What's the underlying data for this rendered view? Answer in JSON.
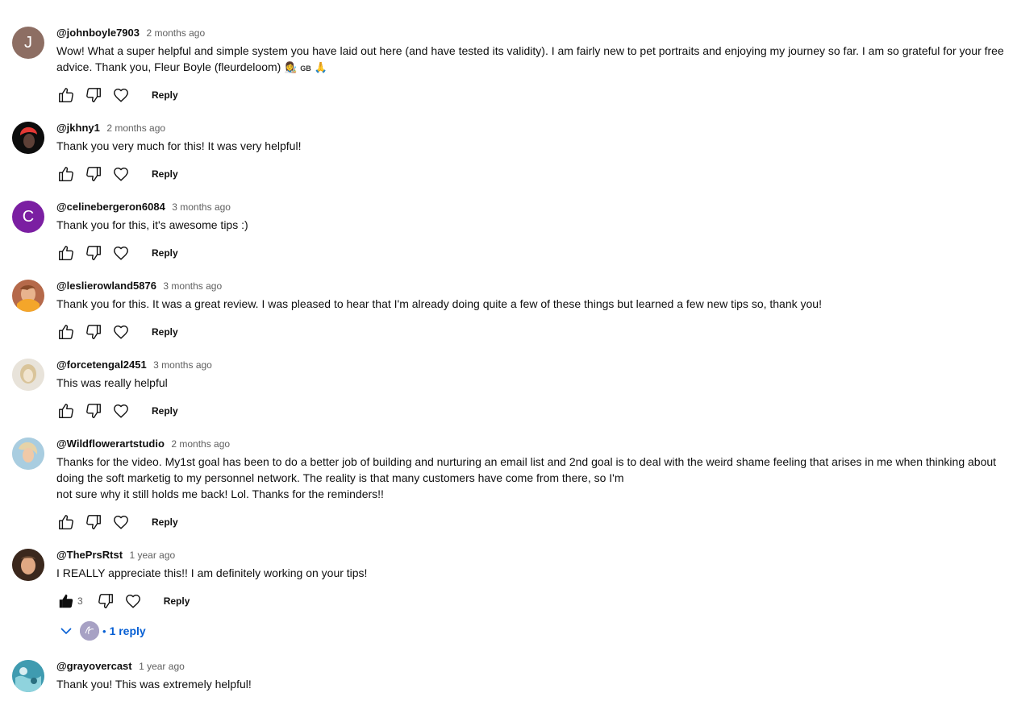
{
  "comments": [
    {
      "author": "@johnboyle7903",
      "time": "2 months ago",
      "text": "Wow!  What a super helpful and simple system you have laid out here (and have tested its validity).  I am fairly new to pet portraits and enjoying my journey so far.  I am so grateful for your free advice.  Thank you, Fleur Boyle (fleurdeloom)",
      "emoji1": "👩‍🎨",
      "flag": "GB",
      "emoji2": "🙏",
      "avatar_letter": "J",
      "avatar_color": "#8d6e63",
      "reply_label": "Reply"
    },
    {
      "author": "@jkhny1",
      "time": "2 months ago",
      "text": "Thank you very much for this! It was very helpful!",
      "reply_label": "Reply"
    },
    {
      "author": "@celinebergeron6084",
      "time": "3 months ago",
      "text": "Thank you for this, it's awesome tips :)",
      "avatar_letter": "C",
      "avatar_color": "#7b1fa2",
      "reply_label": "Reply"
    },
    {
      "author": "@leslierowland5876",
      "time": "3 months ago",
      "text": "Thank you for this. It was a great review. I was pleased to hear that I'm already doing quite a few of these things but learned a few new tips so, thank you!",
      "reply_label": "Reply"
    },
    {
      "author": "@forcetengal2451",
      "time": "3 months ago",
      "text": "This was really helpful",
      "reply_label": "Reply"
    },
    {
      "author": "@Wildflowerartstudio",
      "time": "2 months ago",
      "text_line1": "Thanks for the video.  My1st goal has been to do a better job of building and nurturing an email list and 2nd goal is to deal with the weird shame feeling that arises in me when thinking about doing the soft marketig to my personnel network.   The reality is that many customers have come from there, so I'm",
      "text_line2": "not sure why it still holds me back!  Lol.  Thanks for the reminders!!",
      "reply_label": "Reply"
    },
    {
      "author": "@ThePrsRtst",
      "time": "1 year ago",
      "text": "I REALLY appreciate this!! I am definitely working on your tips!",
      "like_count": "3",
      "reply_label": "Reply",
      "replies_label": "1 reply",
      "replies_separator": "•"
    },
    {
      "author": "@grayovercast",
      "time": "1 year ago",
      "text": "Thank you! This was extremely helpful!"
    }
  ],
  "colors": {
    "link_blue": "#065fd4",
    "meta_gray": "#606060"
  }
}
